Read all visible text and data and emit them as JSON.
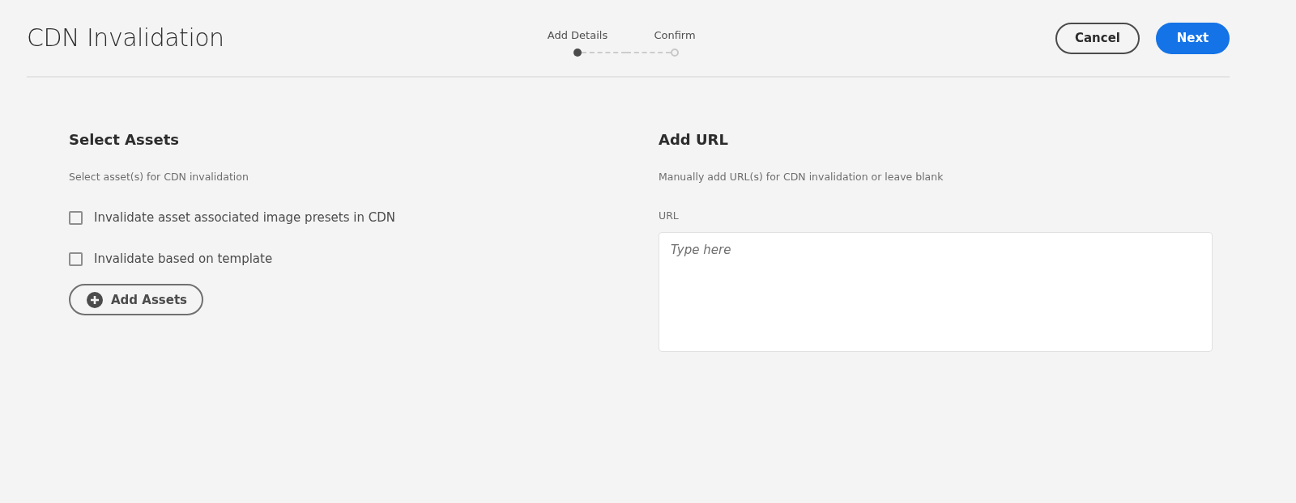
{
  "header": {
    "title": "CDN Invalidation",
    "steps": [
      {
        "label": "Add Details",
        "selected": true
      },
      {
        "label": "Confirm",
        "selected": false
      }
    ],
    "buttons": [
      {
        "label": "Cancel",
        "kind": "secondary"
      },
      {
        "label": "Next",
        "kind": "primary"
      }
    ]
  },
  "select_assets": {
    "heading": "Select Assets",
    "description": "Select asset(s) for CDN invalidation",
    "options": [
      {
        "label": "Invalidate asset associated image presets in CDN",
        "checked": false
      },
      {
        "label": "Invalidate based on template",
        "checked": false
      }
    ],
    "add_button": "Add Assets"
  },
  "add_url": {
    "heading": "Add URL",
    "description": "Manually add URL(s) for CDN invalidation or leave blank",
    "field_label": "URL",
    "placeholder": "Type here"
  }
}
